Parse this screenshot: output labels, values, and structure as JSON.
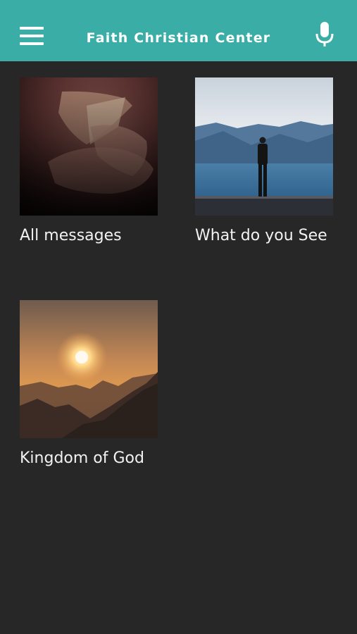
{
  "header": {
    "title": "Faith Christian Center",
    "menu_icon": "hamburger-menu-icon",
    "mic_icon": "microphone-icon",
    "background": "#3aaea6"
  },
  "cards": [
    {
      "label": "All messages",
      "image": "hands-holding-bible"
    },
    {
      "label": "What do you See",
      "image": "man-standing-by-lake-mountains"
    },
    {
      "label": "Kingdom of God",
      "image": "sunset-over-mountains"
    }
  ]
}
